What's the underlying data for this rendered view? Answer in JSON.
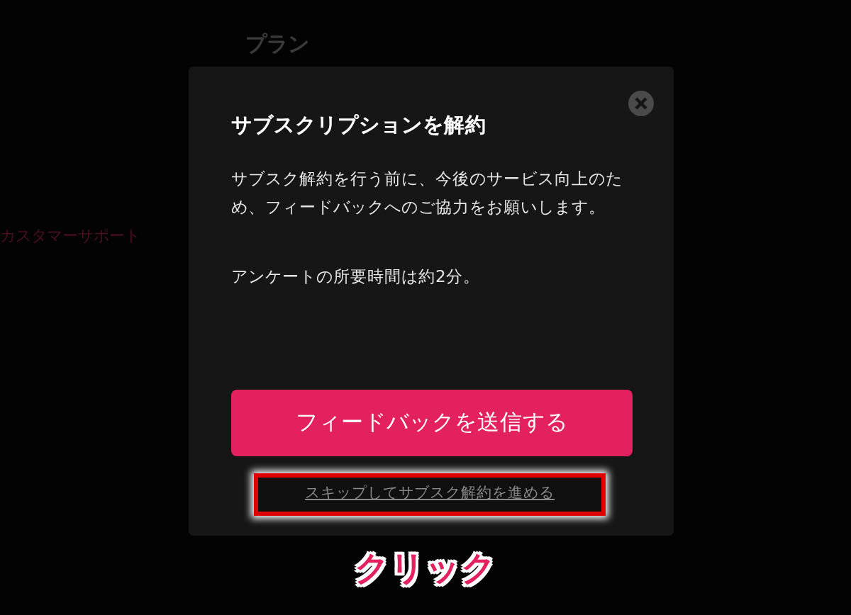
{
  "background_page": {
    "heading": "プラン",
    "sidebar_link": "カスタマーサポート"
  },
  "dialog": {
    "title": "サブスクリプションを解約",
    "message": "サブスク解約を行う前に、今後のサービス向上のため、フィードバックへのご協力をお願いします。",
    "note": "アンケートの所要時間は約2分。",
    "primary_button": "フィードバックを送信する",
    "skip_link": "スキップしてサブスク解約を進める"
  },
  "annotation": {
    "label": "クリック"
  }
}
